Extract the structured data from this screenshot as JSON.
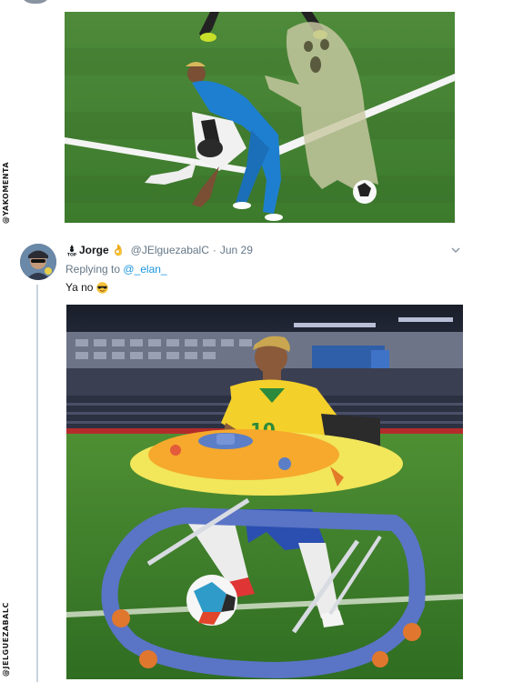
{
  "previous_tweet": {
    "watermark": "@YAKOMENTA",
    "image_alt": "Football player falling on the pitch next to a ghost figure"
  },
  "tweet": {
    "display_name": "Jorge",
    "name_emoji": "👌",
    "handle": "@JElguezabalC",
    "separator": "·",
    "date": "Jun 29",
    "replying_prefix": "Replying to",
    "replying_to": "@_elan_",
    "text": "Ya no",
    "text_emoji": "sunglasses",
    "image_watermark": "@JELGUEZABALC"
  },
  "icons": {
    "badge": "top-badge-icon",
    "caret": "chevron-down-icon",
    "emoji": "sunglasses-icon"
  },
  "colors": {
    "link": "#1b95e0",
    "muted": "#657786",
    "thread_line": "#c9d2da"
  }
}
